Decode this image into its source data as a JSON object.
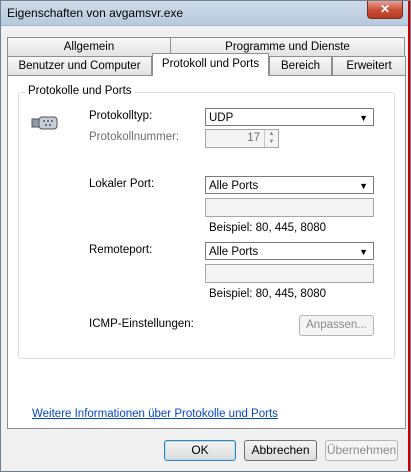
{
  "window": {
    "title": "Eigenschaften von avgamsvr.exe",
    "close_glyph": "✕"
  },
  "tabs": {
    "row_top": [
      {
        "label": "Allgemein"
      },
      {
        "label": "Programme und Dienste"
      }
    ],
    "row_bottom": [
      {
        "label": "Benutzer und Computer"
      },
      {
        "label": "Protokoll und Ports",
        "active": true
      },
      {
        "label": "Bereich"
      },
      {
        "label": "Erweitert"
      }
    ]
  },
  "group": {
    "title": "Protokolle und Ports",
    "protocol_type_label": "Protokolltyp:",
    "protocol_type_value": "UDP",
    "protocol_number_label": "Protokollnummer:",
    "protocol_number_value": "17",
    "local_port_label": "Lokaler Port:",
    "local_port_value": "Alle Ports",
    "local_port_text": "",
    "local_example": "Beispiel: 80, 445, 8080",
    "remote_port_label": "Remoteport:",
    "remote_port_value": "Alle Ports",
    "remote_port_text": "",
    "remote_example": "Beispiel: 80, 445, 8080",
    "icmp_label": "ICMP-Einstellungen:",
    "icmp_button": "Anpassen..."
  },
  "link": {
    "text": "Weitere Informationen über Protokolle und Ports"
  },
  "buttons": {
    "ok": "OK",
    "cancel": "Abbrechen",
    "apply": "Übernehmen"
  },
  "icons": {
    "dropdown": "▼",
    "spin_up": "▲",
    "spin_down": "▼"
  }
}
